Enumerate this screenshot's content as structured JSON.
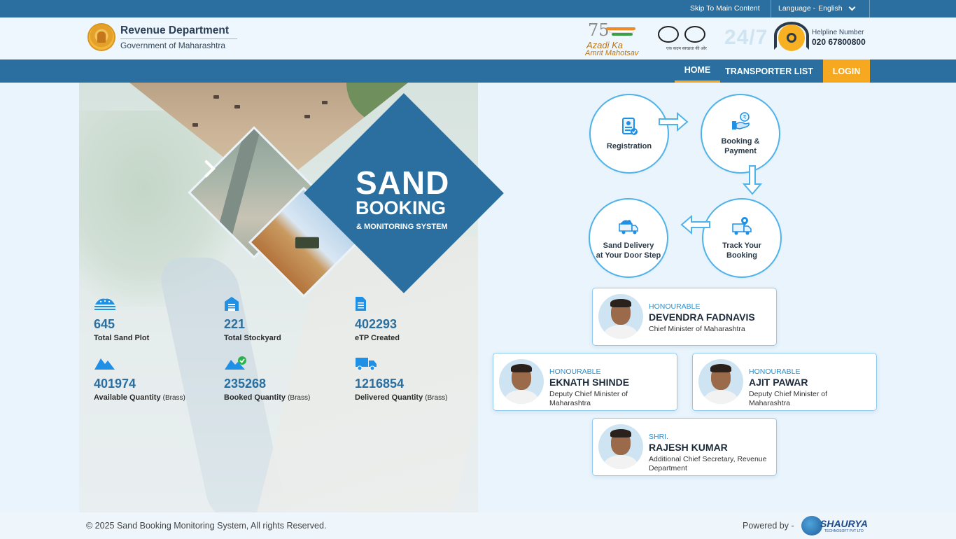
{
  "topbar": {
    "skip_link": "Skip To Main Content",
    "language_label": "Language -",
    "language_value": "English"
  },
  "header": {
    "brand_title": "Revenue Department",
    "brand_subtitle": "Government of Maharashtra",
    "azadi_line1": "Azadi Ka",
    "azadi_line2": "Amrit Mahotsav",
    "azadi_number": "75",
    "swachh_tagline": "एक कदम स्वच्छता की ओर",
    "h247": "24/7",
    "helpline_label": "Helpline Number",
    "helpline_number": "020 67800800"
  },
  "nav": {
    "items": [
      {
        "label": "HOME"
      },
      {
        "label": "TRANSPORTER LIST"
      },
      {
        "label": "LOGIN"
      }
    ]
  },
  "hero": {
    "title_line1": "SAND",
    "title_line2": "BOOKING",
    "subtitle": "& MONITORING SYSTEM"
  },
  "stats": [
    {
      "value": "645",
      "label": "Total Sand Plot",
      "unit": "",
      "icon": "sand-pile-icon"
    },
    {
      "value": "221",
      "label": "Total Stockyard",
      "unit": "",
      "icon": "warehouse-icon"
    },
    {
      "value": "402293",
      "label": "eTP Created",
      "unit": "",
      "icon": "document-icon"
    },
    {
      "value": "401974",
      "label": "Available Quantity",
      "unit": "(Brass)",
      "icon": "sand-heap-icon"
    },
    {
      "value": "235268",
      "label": "Booked Quantity",
      "unit": "(Brass)",
      "icon": "sand-heap-check-icon"
    },
    {
      "value": "1216854",
      "label": "Delivered Quantity",
      "unit": "(Brass)",
      "icon": "truck-icon"
    }
  ],
  "process": [
    {
      "line1": "Registration",
      "line2": "",
      "icon": "registration-icon"
    },
    {
      "line1": "Booking &",
      "line2": "Payment",
      "icon": "payment-icon"
    },
    {
      "line1": "Track Your",
      "line2": "Booking",
      "icon": "tracking-truck-icon"
    },
    {
      "line1": "Sand Delivery",
      "line2": "at Your Door Step",
      "icon": "delivery-truck-icon"
    }
  ],
  "officials": [
    {
      "tag": "HONOURABLE",
      "name": "DEVENDRA FADNAVIS",
      "role": "Chief Minister of Maharashtra"
    },
    {
      "tag": "HONOURABLE",
      "name": "EKNATH SHINDE",
      "role": "Deputy Chief Minister of Maharashtra"
    },
    {
      "tag": "HONOURABLE",
      "name": "AJIT PAWAR",
      "role": "Deputy Chief Minister of Maharashtra"
    },
    {
      "tag": "SHRI.",
      "name": "RAJESH KUMAR",
      "role": "Additional Chief Secretary, Revenue Department"
    }
  ],
  "footer": {
    "copyright": "© 2025 Sand Booking Monitoring System, All rights Reserved.",
    "powered_by": "Powered by -",
    "vendor": "SHAURYA",
    "vendor_sub": "TECHNOSOFT PVT LTD"
  },
  "colors": {
    "primary": "#2a6f9f",
    "accent": "#f6a821",
    "stat_blue": "#2a6f9f",
    "flow_ring": "#4fb3ea",
    "icon_blue": "#1e90e6"
  }
}
